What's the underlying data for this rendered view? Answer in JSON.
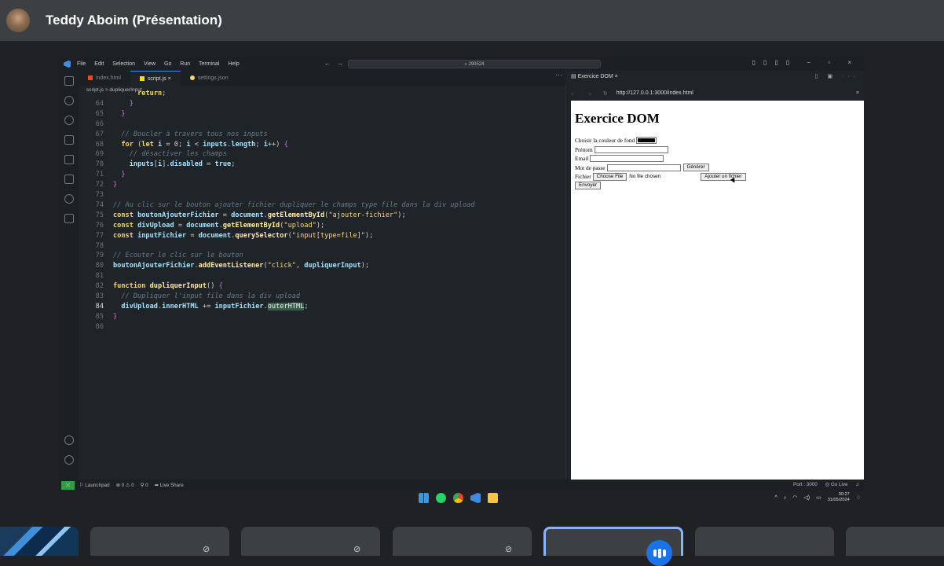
{
  "meeting": {
    "presenter_label": "Teddy Aboim (Présentation)"
  },
  "vscode": {
    "menu": [
      "File",
      "Edit",
      "Selection",
      "View",
      "Go",
      "Run",
      "Terminal",
      "Help"
    ],
    "search_text": "290524",
    "tabs": [
      {
        "label": "index.html",
        "color": "#e44d26"
      },
      {
        "label": "script.js",
        "color": "#f7df1e",
        "active": true
      },
      {
        "label": "settings.json",
        "color": "#f5d76e"
      }
    ],
    "breadcrumb": "script.js > dupliquerInput",
    "code": [
      {
        "n": "",
        "t": "      return;"
      },
      {
        "n": "64",
        "t": "    }"
      },
      {
        "n": "65",
        "t": "  }"
      },
      {
        "n": "66",
        "t": ""
      },
      {
        "n": "67",
        "t": "  // Boucler à travers tous nos inputs"
      },
      {
        "n": "68",
        "t": "  for (let i = 0; i < inputs.length; i++) {"
      },
      {
        "n": "69",
        "t": "    // désactiver les champs"
      },
      {
        "n": "70",
        "t": "    inputs[i].disabled = true;"
      },
      {
        "n": "71",
        "t": "  }"
      },
      {
        "n": "72",
        "t": "}"
      },
      {
        "n": "73",
        "t": ""
      },
      {
        "n": "74",
        "t": "// Au clic sur le bouton ajouter fichier dupliquer le champs type file dans la div upload"
      },
      {
        "n": "75",
        "t": "const boutonAjouterFichier = document.getElementById(\"ajouter-fichier\");"
      },
      {
        "n": "76",
        "t": "const divUpload = document.getElementById(\"upload\");"
      },
      {
        "n": "77",
        "t": "const inputFichier = document.querySelector(\"input[type=file]\");"
      },
      {
        "n": "78",
        "t": ""
      },
      {
        "n": "79",
        "t": "// Ecouter le clic sur le bouton"
      },
      {
        "n": "80",
        "t": "boutonAjouterFichier.addEventListener(\"click\", dupliquerInput);"
      },
      {
        "n": "81",
        "t": ""
      },
      {
        "n": "82",
        "t": "function dupliquerInput() {"
      },
      {
        "n": "83",
        "t": "  // Dupliquer l'input file dans la div upload"
      },
      {
        "n": "84",
        "t": "  divUpload.innerHTML += inputFichier.outerHTML;"
      },
      {
        "n": "85",
        "t": "}"
      },
      {
        "n": "86",
        "t": ""
      }
    ],
    "status": {
      "launchpad": "Launchpad",
      "problems": "⊗ 0 ⚠ 0",
      "ports_count": "⚲ 0",
      "live_share": "Live Share",
      "port": "Port : 3000",
      "go_live": "Go Live"
    }
  },
  "browser": {
    "tab_title": "Exercice DOM",
    "url": "http://127.0.0.1:3000/index.html",
    "heading": "Exercice DOM",
    "color_label": "Choisir la couleur de fond",
    "color_value": "#000000",
    "prenom_label": "Prénom",
    "email_label": "Email",
    "password_label": "Mot de passe",
    "generate_button": "Générer",
    "file_label": "Fichier",
    "choose_file_button": "Choose File",
    "no_file_text": "No file chosen",
    "add_file_button": "Ajouter un fichier",
    "submit_button": "Envoyer"
  },
  "taskbar": {
    "time": "00:27",
    "date": "31/05/2024"
  }
}
